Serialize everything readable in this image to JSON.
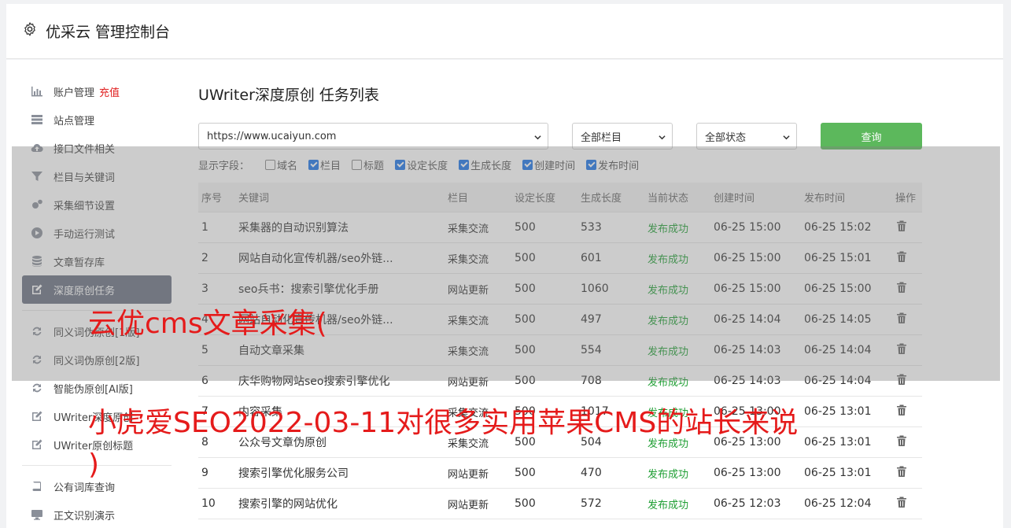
{
  "header": {
    "title": "优采云 管理控制台",
    "icon": "gear-icon"
  },
  "sidebar": {
    "items": [
      {
        "label": "账户管理",
        "icon": "bar-chart-icon",
        "badge": "充值"
      },
      {
        "label": "站点管理",
        "icon": "server-icon"
      },
      {
        "label": "接口文件相关",
        "icon": "cloud-upload-icon"
      },
      {
        "label": "栏目与关键词",
        "icon": "filter-icon"
      },
      {
        "label": "采集细节设置",
        "icon": "gears-icon"
      },
      {
        "label": "手动运行测试",
        "icon": "play-circle-icon"
      },
      {
        "label": "文章暂存库",
        "icon": "database-icon"
      },
      {
        "label": "深度原创任务",
        "icon": "edit-icon",
        "active": true
      },
      {
        "label": "同义词伪原创[1版]",
        "icon": "refresh-icon"
      },
      {
        "label": "同义词伪原创[2版]",
        "icon": "refresh-icon"
      },
      {
        "label": "智能伪原创[AI版]",
        "icon": "refresh-icon"
      },
      {
        "label": "UWriter深度原创",
        "icon": "edit-icon"
      },
      {
        "label": "UWriter原创标题",
        "icon": "edit-icon"
      },
      {
        "label": "公有词库查询",
        "icon": "book-icon"
      },
      {
        "label": "正文识别演示",
        "icon": "monitor-icon"
      }
    ]
  },
  "main": {
    "title": "UWriter深度原创 任务列表",
    "site_select": "https://www.ucaiyun.com",
    "column_select": "全部栏目",
    "status_select": "全部状态",
    "query_button": "查询",
    "fields_label": "显示字段：",
    "fields": [
      {
        "label": "域名",
        "checked": false
      },
      {
        "label": "栏目",
        "checked": true
      },
      {
        "label": "标题",
        "checked": false
      },
      {
        "label": "设定长度",
        "checked": true
      },
      {
        "label": "生成长度",
        "checked": true
      },
      {
        "label": "创建时间",
        "checked": true
      },
      {
        "label": "发布时间",
        "checked": true
      }
    ],
    "columns": [
      "序号",
      "关键词",
      "栏目",
      "设定长度",
      "生成长度",
      "当前状态",
      "创建时间",
      "发布时间",
      "操作"
    ],
    "rows": [
      [
        "1",
        "采集器的自动识别算法",
        "采集交流",
        "500",
        "533",
        "发布成功",
        "06-25 15:00",
        "06-25 15:02"
      ],
      [
        "2",
        "网站自动化宣传机器/seo外链...",
        "采集交流",
        "500",
        "601",
        "发布成功",
        "06-25 15:00",
        "06-25 15:01"
      ],
      [
        "3",
        "seo兵书：搜索引擎优化手册",
        "网站更新",
        "500",
        "1060",
        "发布成功",
        "06-25 15:00",
        "06-25 15:00"
      ],
      [
        "4",
        "网站自动化宣传机器/seo外链...",
        "采集交流",
        "500",
        "497",
        "发布成功",
        "06-25 14:04",
        "06-25 14:05"
      ],
      [
        "5",
        "自动文章采集",
        "采集交流",
        "500",
        "554",
        "发布成功",
        "06-25 14:03",
        "06-25 14:04"
      ],
      [
        "6",
        "庆华购物网站seo搜索引擎优化",
        "网站更新",
        "500",
        "708",
        "发布成功",
        "06-25 14:03",
        "06-25 14:04"
      ],
      [
        "7",
        "内容采集",
        "采集交流",
        "500",
        "1017",
        "发布成功",
        "06-25 13:00",
        "06-25 13:01"
      ],
      [
        "8",
        "公众号文章伪原创",
        "采集交流",
        "500",
        "504",
        "发布成功",
        "06-25 13:00",
        "06-25 13:01"
      ],
      [
        "9",
        "搜索引擎优化服务公司",
        "网站更新",
        "500",
        "470",
        "发布成功",
        "06-25 13:00",
        "06-25 13:01"
      ],
      [
        "10",
        "搜索引擎的网站优化",
        "网站更新",
        "500",
        "572",
        "发布成功",
        "06-25 12:03",
        "06-25 12:04"
      ]
    ]
  },
  "watermark": {
    "line1": "云优cms文章采集(",
    "line2": "小虎爱SEO2022-03-11对很多实用苹果CMS的站长来说",
    "line3": ")"
  },
  "colors": {
    "accent_green": "#5cb85c",
    "status_green": "#1e9e33",
    "active_bg": "#6a7180",
    "watermark": "#e51b1b",
    "badge_red": "#e02020"
  }
}
